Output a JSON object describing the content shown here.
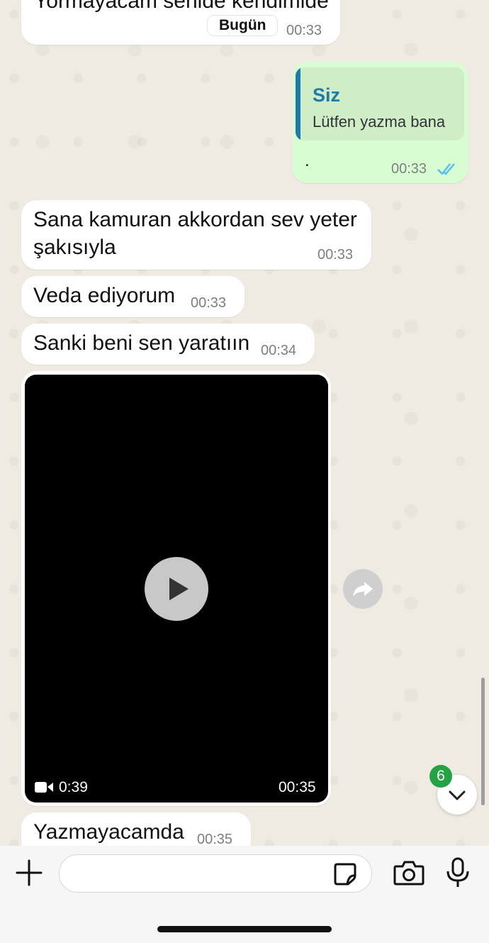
{
  "messages": [
    {
      "id": "m1",
      "direction": "incoming",
      "text": "Yormayacam senide kendimide",
      "time": "00:33",
      "day_badge": "Bugün"
    },
    {
      "id": "m2",
      "direction": "outgoing",
      "quote_sender": "Siz",
      "quote_text": "Lütfen yazma bana",
      "text": ".",
      "time": "00:33",
      "status": "read"
    },
    {
      "id": "m3",
      "direction": "incoming",
      "text_line1": "Sana kamuran akkordan sev yeter",
      "text_line2": "şakısıyla",
      "time": "00:33"
    },
    {
      "id": "m4",
      "direction": "incoming",
      "text": "Veda ediyorum",
      "time": "00:33"
    },
    {
      "id": "m5",
      "direction": "incoming",
      "text": "Sanki beni sen yaratıın",
      "time": "00:34"
    },
    {
      "id": "m6",
      "direction": "incoming",
      "type": "video",
      "duration": "0:39",
      "time": "00:35"
    },
    {
      "id": "m7",
      "direction": "incoming",
      "text": "Yazmayacamda",
      "time": "00:35"
    }
  ],
  "scroll_down": {
    "unread_count": "6"
  },
  "composer": {
    "placeholder": ""
  },
  "colors": {
    "outgoing_bubble": "#d9fdd3",
    "incoming_bubble": "#ffffff",
    "read_ticks": "#53bdeb",
    "unread_badge": "#25a244",
    "quote_bar": "#1f7aa8"
  },
  "icons": [
    "plus-icon",
    "sticker-icon",
    "camera-icon",
    "microphone-icon",
    "play-icon",
    "forward-icon",
    "video-camera-icon",
    "chevron-down-icon",
    "double-check-icon"
  ]
}
